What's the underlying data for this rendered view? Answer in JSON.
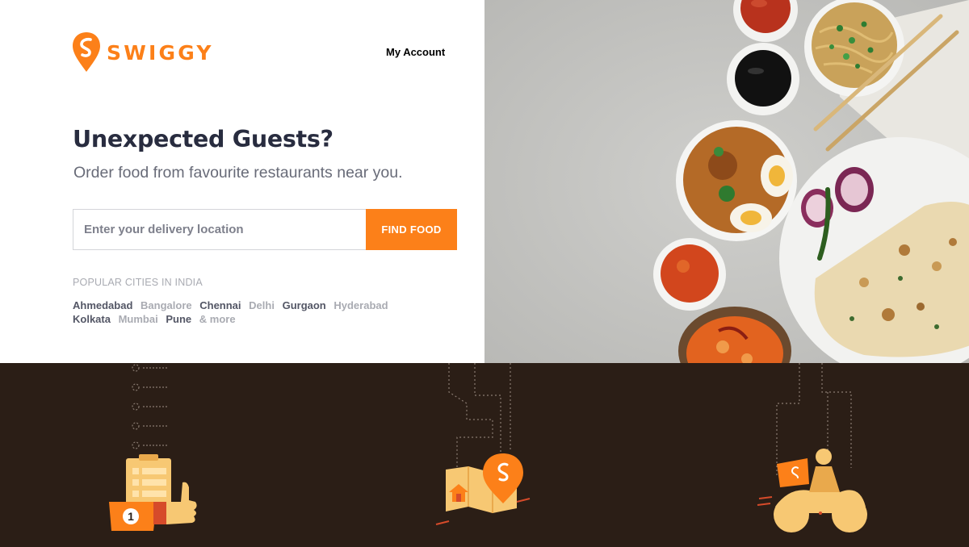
{
  "brand": {
    "name": "SWIGGY",
    "color": "#fc8019"
  },
  "header": {
    "account_label": "My Account"
  },
  "hero": {
    "title": "Unexpected Guests?",
    "subtitle": "Order food from favourite restaurants near you."
  },
  "search": {
    "placeholder": "Enter your delivery location",
    "value": "",
    "button_label": "FIND FOOD"
  },
  "cities": {
    "heading": "POPULAR CITIES IN INDIA",
    "items": [
      {
        "label": "Ahmedabad",
        "tone": "dark"
      },
      {
        "label": "Bangalore",
        "tone": "light"
      },
      {
        "label": "Chennai",
        "tone": "dark"
      },
      {
        "label": "Delhi",
        "tone": "light"
      },
      {
        "label": "Gurgaon",
        "tone": "dark"
      },
      {
        "label": "Hyderabad",
        "tone": "light"
      },
      {
        "label": "Kolkata",
        "tone": "dark"
      },
      {
        "label": "Mumbai",
        "tone": "light"
      },
      {
        "label": "Pune",
        "tone": "dark"
      },
      {
        "label": "& more",
        "tone": "light"
      }
    ]
  },
  "illustrations": {
    "order_badge": "1",
    "items": [
      "clipboard-thumbs-up-icon",
      "map-pin-icon",
      "delivery-scooter-icon"
    ]
  },
  "colors": {
    "accent": "#fc8019",
    "band": "#2b1e16",
    "food_bg": "#c4c4c1"
  }
}
